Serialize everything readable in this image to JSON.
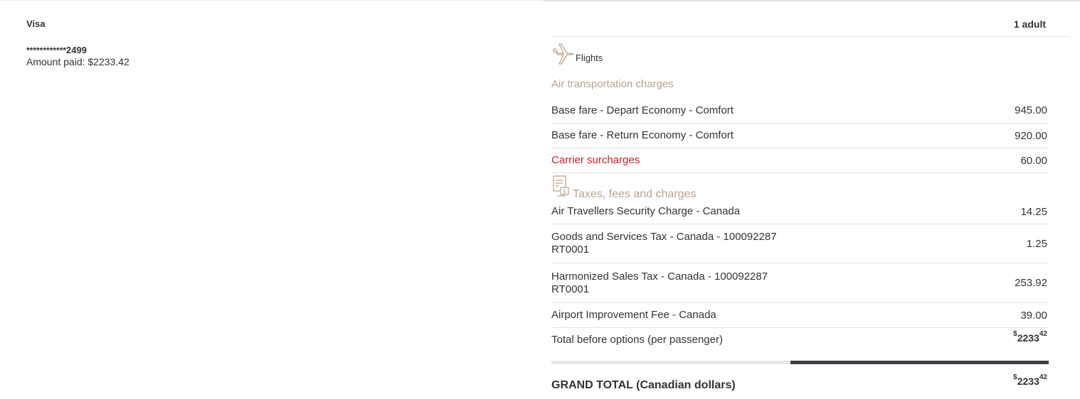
{
  "payment": {
    "method": "Visa",
    "card_mask": "************",
    "card_last4": "2499",
    "amount_paid": "Amount paid: $2233.42"
  },
  "summary": {
    "passengers": "1 adult",
    "flights_label": "Flights",
    "flights_icon": "airplane-icon",
    "air_section_title": "Air transportation charges",
    "air_rows": [
      {
        "label": "Base fare - Depart Economy - Comfort",
        "value": "945.00"
      },
      {
        "label": "Base fare - Return Economy - Comfort",
        "value": "920.00"
      },
      {
        "label": "Carrier surcharges",
        "value": "60.00"
      }
    ],
    "taxes_icon": "receipt-icon",
    "taxes_title": "Taxes, fees and charges",
    "tax_rows": [
      {
        "label": "Air Travellers Security Charge - Canada",
        "value": "14.25"
      },
      {
        "label": "Goods and Services Tax - Canada - 100092287 RT0001",
        "value": "1.25"
      },
      {
        "label": "Harmonized Sales Tax - Canada - 100092287 RT0001",
        "value": "253.92"
      },
      {
        "label": "Airport Improvement Fee - Canada",
        "value": "39.00"
      }
    ],
    "total_before_label": "Total before options (per passenger)",
    "total_before": {
      "currency": "$",
      "dollars": "2233",
      "cents": "42"
    },
    "progress_fraction": 0.52,
    "grand_total_label": "GRAND TOTAL (Canadian dollars)",
    "grand_total": {
      "currency": "$",
      "dollars": "2233",
      "cents": "42"
    }
  },
  "colors": {
    "accent_tan": "#b8a48f",
    "surcharge_red": "#d0202a",
    "progress_dark": "#3d4044"
  }
}
